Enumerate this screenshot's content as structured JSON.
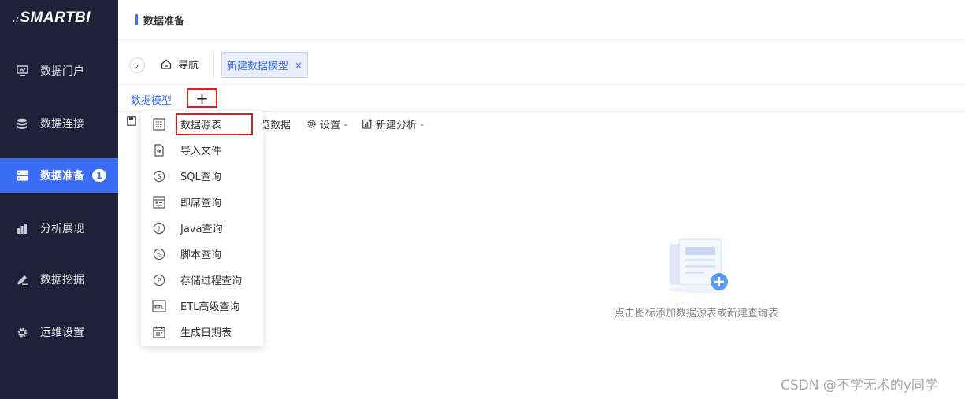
{
  "brand": {
    "logo_mark": ".:",
    "logo_text": "SMARTBI"
  },
  "sidebar": {
    "items": [
      {
        "label": "数据门户",
        "icon": "portal-icon"
      },
      {
        "label": "数据连接",
        "icon": "database-icon"
      },
      {
        "label": "数据准备",
        "icon": "server-icon",
        "badge": "1",
        "active": true
      },
      {
        "label": "分析展现",
        "icon": "bar-chart-icon"
      },
      {
        "label": "数据挖掘",
        "icon": "pen-icon"
      },
      {
        "label": "运维设置",
        "icon": "gear-icon"
      }
    ]
  },
  "header": {
    "title": "数据准备"
  },
  "tabs": {
    "collapse_glyph": "›",
    "home_label": "导航",
    "active_label": "新建数据模型",
    "close_glyph": "×"
  },
  "subtabs": {
    "model_label": "数据模型",
    "add_glyph": "+"
  },
  "toolbar": {
    "preview_label": "览数据",
    "settings_label": "设置",
    "new_analysis_label": "新建分析",
    "caret": "⌄"
  },
  "menu": {
    "items": [
      {
        "label": "数据源表",
        "icon": "table-icon"
      },
      {
        "label": "导入文件",
        "icon": "file-import-icon"
      },
      {
        "label": "SQL查询",
        "icon": "sql-icon"
      },
      {
        "label": "即席查询",
        "icon": "adhoc-icon"
      },
      {
        "label": "Java查询",
        "icon": "java-icon"
      },
      {
        "label": "脚本查询",
        "icon": "script-icon"
      },
      {
        "label": "存储过程查询",
        "icon": "procedure-icon"
      },
      {
        "label": "ETL高级查询",
        "icon": "etl-icon"
      },
      {
        "label": "生成日期表",
        "icon": "calendar-icon"
      }
    ]
  },
  "empty_state": {
    "text": "点击图标添加数据源表或新建查询表"
  },
  "watermark": "CSDN @不学无术的y同学",
  "colors": {
    "sidebar_bg": "#1d2238",
    "accent": "#3a6cf5",
    "highlight_border": "#e02020"
  }
}
